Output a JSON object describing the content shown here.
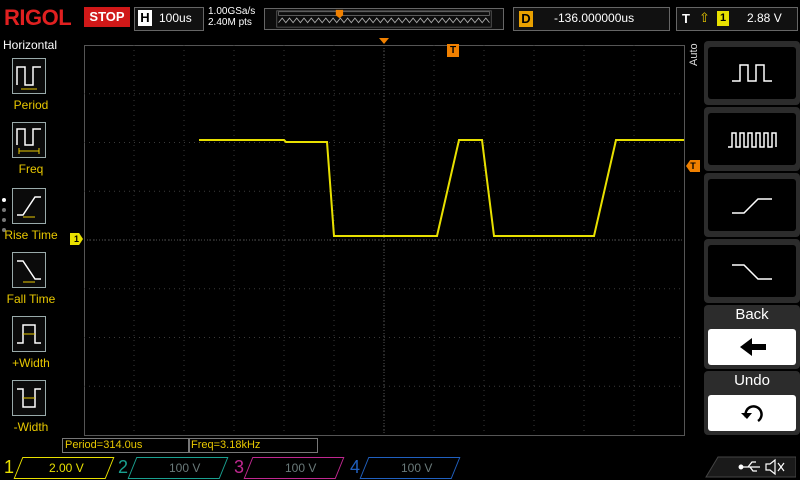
{
  "top": {
    "logo": "RIGOL",
    "run_state": "STOP",
    "h_letter": "H",
    "timebase": "100us",
    "sample_rate": "1.00GSa/s",
    "mem_depth": "2.40M pts",
    "d_letter": "D",
    "delay": "-136.000000us",
    "t_letter": "T",
    "trigger_source": "1",
    "trigger_level": "2.88 V"
  },
  "left_menu": {
    "title": "Horizontal",
    "items": [
      {
        "label": "Period"
      },
      {
        "label": "Freq"
      },
      {
        "label": "Rise Time"
      },
      {
        "label": "Fall Time"
      },
      {
        "label": "+Width"
      },
      {
        "label": "-Width"
      }
    ]
  },
  "right_menu": {
    "auto_label": "Auto",
    "back_label": "Back",
    "undo_label": "Undo"
  },
  "markers": {
    "ch1_marker": "1",
    "trig_pos": "T",
    "trig_level": "T"
  },
  "measurements": {
    "period": "Period=314.0us",
    "freq": "Freq=3.18kHz"
  },
  "channels": [
    {
      "num": "1",
      "scale": "2.00 V",
      "color": "#e8e000"
    },
    {
      "num": "2",
      "scale": "100 V",
      "color": "#1aa090"
    },
    {
      "num": "3",
      "scale": "100 V",
      "color": "#c02890"
    },
    {
      "num": "4",
      "scale": "100 V",
      "color": "#2060c0"
    }
  ],
  "colors": {
    "trace": "#e8e000",
    "trigger": "#f08000",
    "stop": "#d01818"
  }
}
